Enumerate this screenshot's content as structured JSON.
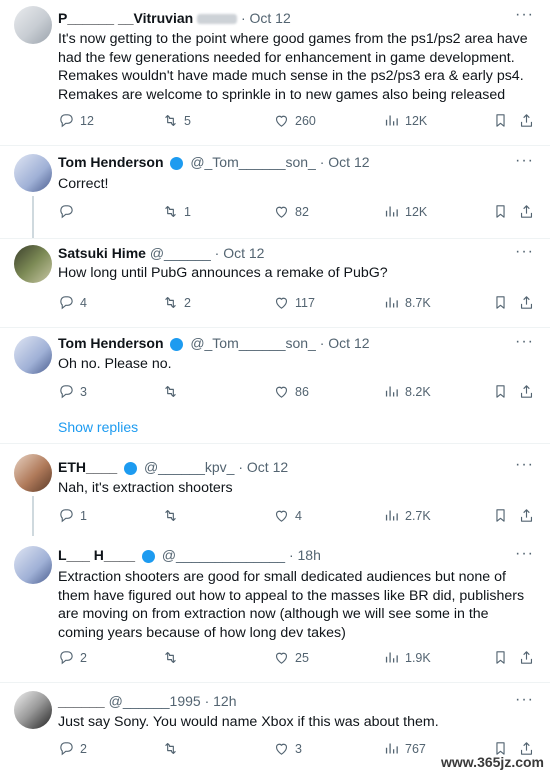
{
  "tweets": [
    {
      "name": "P______ __Vitruvian",
      "handle": "",
      "time": "· Oct 12",
      "text": "It's now getting to the point where good games from the ps1/ps2 area have had the few generations needed for enhancement in game development. Remakes wouldn't have made much sense in the ps2/ps3 era & early ps4. Remakes are welcome to sprinkle in to new games also being released",
      "replies": "12",
      "reposts": "5",
      "likes": "260",
      "views": "12K"
    },
    {
      "name": "Tom Henderson",
      "handle": "@_Tom______son_",
      "time": "· Oct 12",
      "text": "Correct!",
      "replies": "",
      "reposts": "1",
      "likes": "82",
      "views": "12K"
    },
    {
      "name": "Satsuki Hime",
      "handle": "@______",
      "time": "· Oct 12",
      "text": "How long until PubG announces a remake of PubG?",
      "replies": "4",
      "reposts": "2",
      "likes": "117",
      "views": "8.7K"
    },
    {
      "name": "Tom Henderson",
      "handle": "@_Tom______son_",
      "time": "· Oct 12",
      "text": "Oh no. Please no.",
      "replies": "3",
      "reposts": "",
      "likes": "86",
      "views": "8.2K"
    },
    {
      "name": "ETH____",
      "handle": "@______kpv_",
      "time": "· Oct 12",
      "text": "Nah, it's extraction shooters",
      "replies": "1",
      "reposts": "",
      "likes": "4",
      "views": "2.7K"
    },
    {
      "name": "L___ H____",
      "handle": "@______________",
      "time": "· 18h",
      "text": "Extraction shooters are good for small dedicated audiences but none of them have figured out how to appeal to the masses like BR did, publishers are moving on from extraction now (although we will see some in the coming years because of how long dev takes)",
      "replies": "2",
      "reposts": "",
      "likes": "25",
      "views": "1.9K"
    },
    {
      "name": "______",
      "handle": "@______1995",
      "time": "· 12h",
      "text": "Just say Sony. You would name Xbox if this was about them.",
      "replies": "2",
      "reposts": "",
      "likes": "3",
      "views": "767"
    }
  ],
  "show_replies": "Show replies",
  "more_icon": "···",
  "watermark": "www.365jz.com",
  "colors": {
    "link": "#1d9bf0",
    "muted": "#536471",
    "text": "#0f1419"
  }
}
